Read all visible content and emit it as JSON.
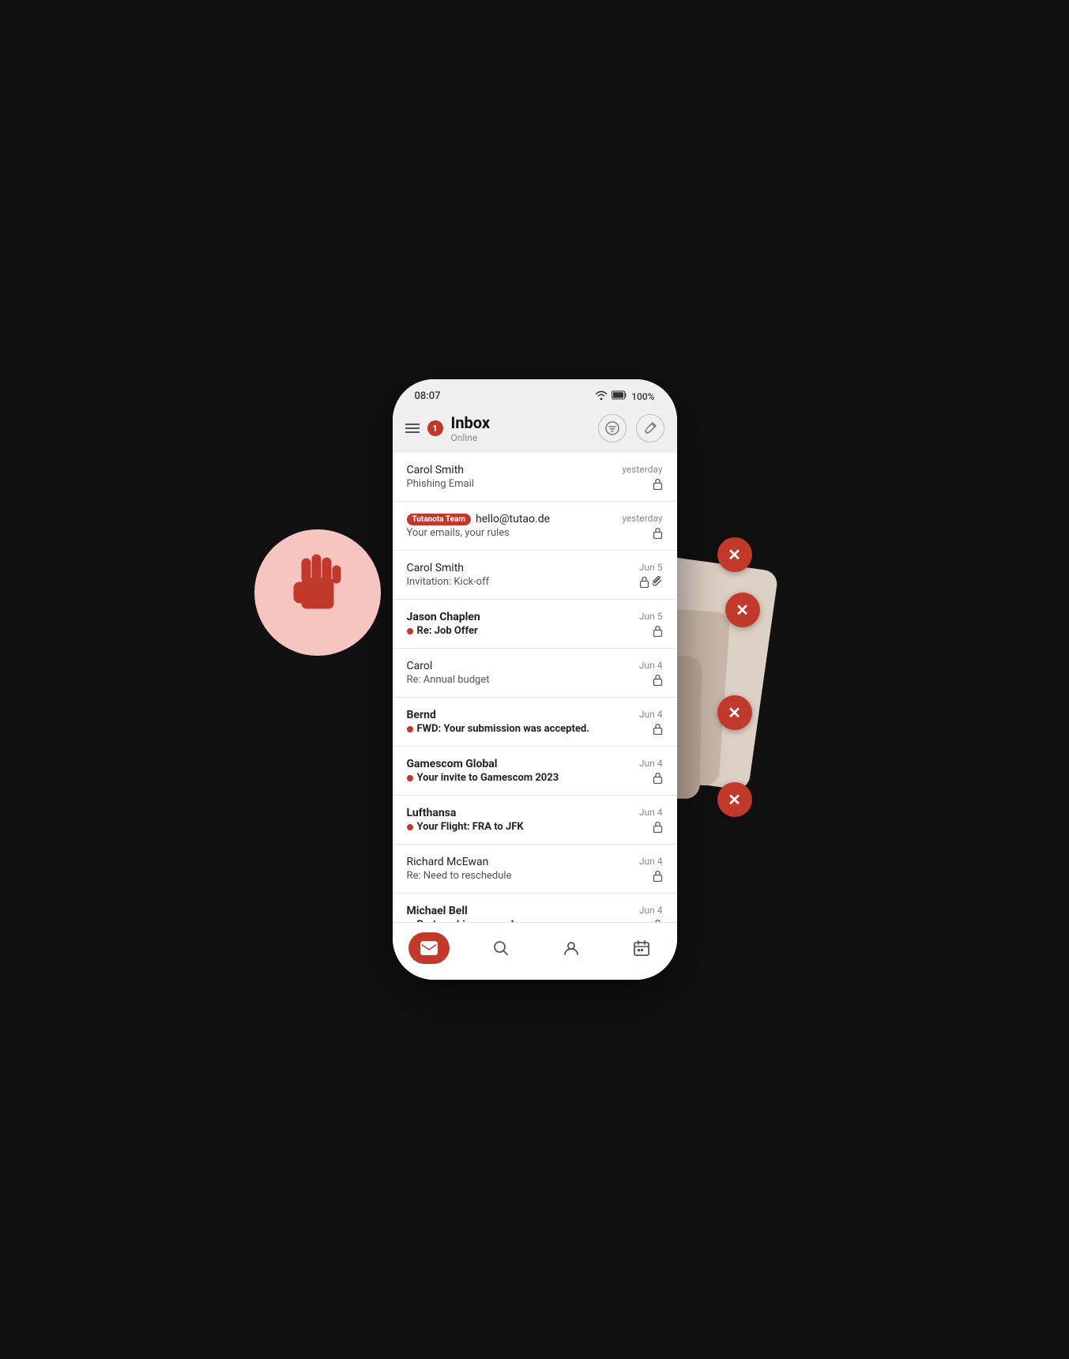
{
  "statusBar": {
    "time": "08:07",
    "signal": "📶",
    "battery": "100%"
  },
  "header": {
    "notificationCount": "1",
    "title": "Inbox",
    "subtitle": "Online",
    "filterIcon": "≡",
    "editIcon": "✎"
  },
  "emails": [
    {
      "sender": "Carol Smith",
      "date": "yesterday",
      "subject": "Phishing Email",
      "unread": false,
      "lock": true,
      "paperclip": false,
      "tutanota": false,
      "tutanotaEmail": ""
    },
    {
      "sender": "Tutanota Team",
      "tutanotaEmail": "hello@tutao.de",
      "date": "yesterday",
      "subject": "Your emails, your rules",
      "unread": false,
      "lock": true,
      "paperclip": false,
      "tutanota": true
    },
    {
      "sender": "Carol Smith",
      "date": "Jun 5",
      "subject": "Invitation: Kick-off",
      "unread": false,
      "lock": true,
      "paperclip": true,
      "tutanota": false,
      "tutanotaEmail": ""
    },
    {
      "sender": "Jason Chaplen",
      "date": "Jun 5",
      "subject": "Re: Job Offer",
      "unread": true,
      "lock": true,
      "paperclip": false,
      "tutanota": false,
      "tutanotaEmail": ""
    },
    {
      "sender": "Carol",
      "date": "Jun 4",
      "subject": "Re: Annual budget",
      "unread": false,
      "lock": true,
      "paperclip": false,
      "tutanota": false,
      "tutanotaEmail": ""
    },
    {
      "sender": "Bernd",
      "date": "Jun 4",
      "subject": "FWD: Your submission was accepted.",
      "unread": true,
      "lock": true,
      "paperclip": false,
      "tutanota": false,
      "tutanotaEmail": ""
    },
    {
      "sender": "Gamescom Global",
      "date": "Jun 4",
      "subject": "Your invite to Gamescom 2023",
      "unread": true,
      "lock": true,
      "paperclip": false,
      "tutanota": false,
      "tutanotaEmail": ""
    },
    {
      "sender": "Lufthansa",
      "date": "Jun 4",
      "subject": "Your Flight: FRA to JFK",
      "unread": true,
      "lock": true,
      "paperclip": false,
      "tutanota": false,
      "tutanotaEmail": ""
    },
    {
      "sender": "Richard McEwan",
      "date": "Jun 4",
      "subject": "Re: Need to reschedule",
      "unread": false,
      "lock": true,
      "paperclip": false,
      "tutanota": false,
      "tutanotaEmail": ""
    },
    {
      "sender": "Michael Bell",
      "date": "Jun 4",
      "subject": "Partnership proposal",
      "unread": true,
      "lock": true,
      "paperclip": false,
      "tutanota": false,
      "tutanotaEmail": ""
    }
  ],
  "bottomNav": {
    "mailLabel": "mail",
    "searchLabel": "search",
    "contactLabel": "contact",
    "calendarLabel": "calendar"
  },
  "xButtons": [
    "✕",
    "✕",
    "✕",
    "✕"
  ],
  "handIcon": "✋"
}
